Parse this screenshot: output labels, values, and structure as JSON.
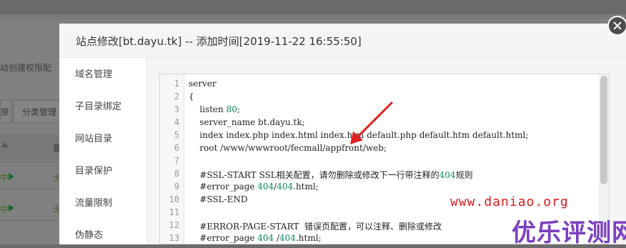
{
  "background": {
    "hint_text": "动创建权限配",
    "buttons": [
      "原",
      "分类管理"
    ],
    "status_label": "无",
    "flag_icon": "play-icon"
  },
  "modal": {
    "title": "站点修改[bt.dayu.tk] -- 添加时间[2019-11-22 16:55:50]",
    "sidebar": [
      "域名管理",
      "子目录绑定",
      "网站目录",
      "目录保护",
      "流量限制",
      "伪静态"
    ],
    "editor": {
      "line_numbers": [
        "1",
        "2",
        "3",
        "4",
        "5",
        "6",
        "7",
        "8",
        "9",
        "10",
        "11",
        "12",
        "13"
      ],
      "lines": [
        "server",
        "{",
        "    listen 80;",
        "    server_name bt.dayu.tk;",
        "    index index.php index.html index.htm default.php default.htm default.html;",
        "    root /www/wwwroot/fecmall/appfront/web;",
        "",
        "    #SSL-START SSL相关配置，请勿删除或修改下一行带注释的404规则",
        "    #error_page 404/404.html;",
        "    #SSL-END",
        "",
        "    #ERROR-PAGE-START  错误页配置，可以注释、删除或修改",
        "    #error_page 404 /404.html;"
      ]
    }
  },
  "watermark": {
    "url": "www.daniao.org",
    "brand": "优乐评测网"
  },
  "colors": {
    "arrow": "#e02020",
    "number": "#09885a",
    "brand": "#7a3fc0"
  }
}
